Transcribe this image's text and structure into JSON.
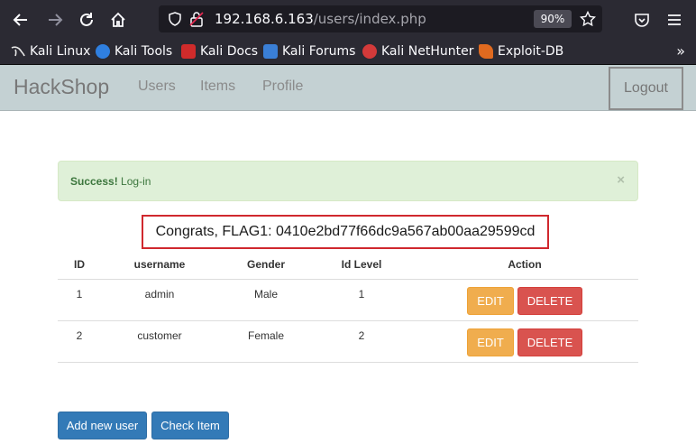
{
  "browser": {
    "url_host": "192.168.6.163",
    "url_path": "/users/index.php",
    "zoom": "90%",
    "bookmarks": [
      {
        "label": "Kali Linux",
        "color": "#e6e6e6"
      },
      {
        "label": "Kali Tools",
        "color": "#2f7fe0"
      },
      {
        "label": "Kali Docs",
        "color": "#cf2b2b"
      },
      {
        "label": "Kali Forums",
        "color": "#3a7fd6"
      },
      {
        "label": "Kali NetHunter",
        "color": "#d33a3a"
      },
      {
        "label": "Exploit-DB",
        "color": "#e06a1f"
      }
    ]
  },
  "navbar": {
    "brand": "HackShop",
    "links": [
      "Users",
      "Items",
      "Profile"
    ],
    "logout": "Logout"
  },
  "alert": {
    "strong": "Success!",
    "text": "Log-in",
    "close": "×"
  },
  "flag": "Congrats, FLAG1: 0410e2bd77f66dc9a567ab00aa29599cd",
  "table": {
    "headers": [
      "ID",
      "username",
      "Gender",
      "Id Level",
      "Action"
    ],
    "rows": [
      {
        "id": "1",
        "username": "admin",
        "gender": "Male",
        "level": "1",
        "edit": "EDIT",
        "delete": "DELETE"
      },
      {
        "id": "2",
        "username": "customer",
        "gender": "Female",
        "level": "2",
        "edit": "EDIT",
        "delete": "DELETE"
      }
    ]
  },
  "actions": {
    "add_user": "Add new user",
    "check_item": "Check Item"
  },
  "colors": {
    "success_bg": "#dff0d8",
    "flag_border": "#d0282e",
    "edit": "#f0ad4e",
    "delete": "#d9534f",
    "primary": "#337ab7"
  }
}
